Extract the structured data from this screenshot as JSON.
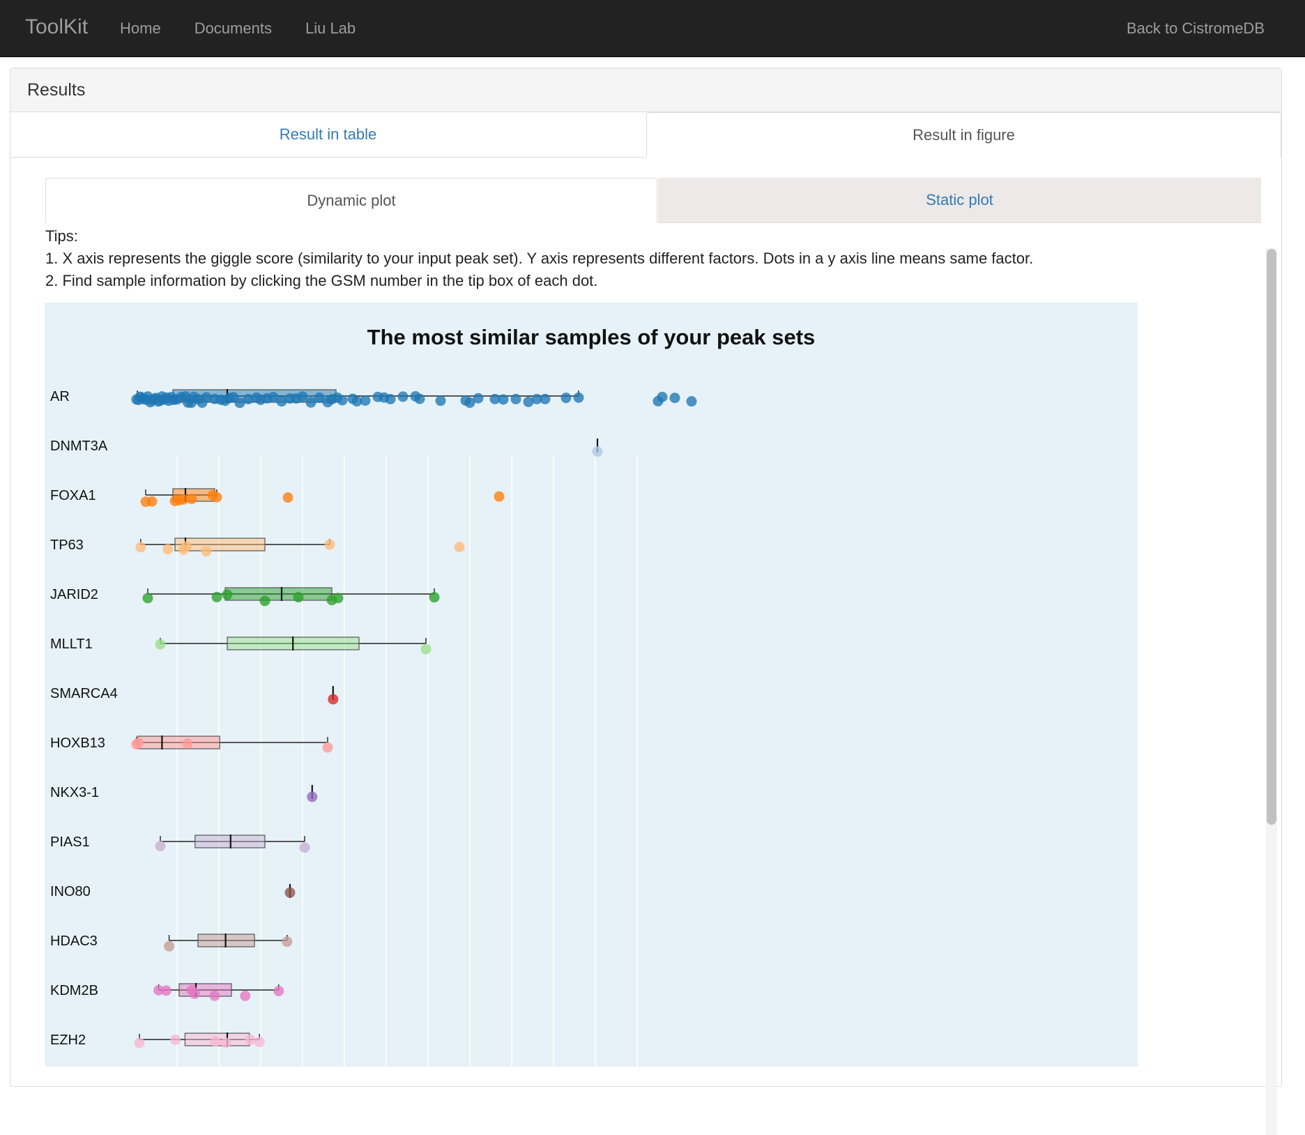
{
  "navbar": {
    "brand": "ToolKit",
    "links": [
      "Home",
      "Documents",
      "Liu Lab"
    ],
    "right_link": "Back to CistromeDB"
  },
  "panel": {
    "title": "Results"
  },
  "result_tabs": [
    {
      "label": "Result in table",
      "active": false
    },
    {
      "label": "Result in figure",
      "active": true
    }
  ],
  "plot_tabs": [
    {
      "label": "Dynamic plot",
      "active": true
    },
    {
      "label": "Static plot",
      "active": false
    }
  ],
  "tips": {
    "heading": "Tips:",
    "line1": "1. X axis represents the giggle score (similarity to your input peak set). Y axis represents different factors. Dots in a y axis line means same factor.",
    "line2": "2. Find sample information by clicking the GSM number in the tip box of each dot."
  },
  "chart_data": {
    "type": "box",
    "title": "The most similar samples of your peak sets",
    "xlabel": "",
    "ylabel": "",
    "xlim": [
      0,
      140
    ],
    "grid": true,
    "gridlines_x": [
      10,
      20,
      30,
      40,
      50,
      60,
      70,
      80,
      90,
      100,
      110,
      120
    ],
    "categories": [
      "AR",
      "DNMT3A",
      "FOXA1",
      "TP63",
      "JARID2",
      "MLLT1",
      "SMARCA4",
      "HOXB13",
      "NKX3-1",
      "PIAS1",
      "INO80",
      "HDAC3",
      "KDM2B",
      "EZH2"
    ],
    "series": [
      {
        "category": "AR",
        "color": "#1f77b4",
        "min": 0.5,
        "q1": 9,
        "median": 22,
        "q3": 48,
        "max": 106,
        "points": [
          0.3,
          0.8,
          1.2,
          1.6,
          2.1,
          2.5,
          3,
          3.6,
          4,
          4.5,
          5,
          5.5,
          6,
          6.4,
          7,
          7.5,
          8,
          8.6,
          9.2,
          10,
          11,
          12,
          12.6,
          13.4,
          14,
          15,
          16,
          17,
          19,
          20.5,
          21.5,
          22.5,
          23.5,
          25,
          27,
          29,
          30,
          31.5,
          33,
          35,
          37,
          38.5,
          40,
          42,
          44,
          46,
          47,
          48.3,
          49.5,
          52,
          53,
          55,
          58,
          59.5,
          61,
          64,
          67,
          68,
          73,
          79,
          80,
          82,
          86,
          88,
          91,
          94,
          96,
          98,
          103,
          106,
          125,
          126,
          129,
          133
        ]
      },
      {
        "category": "DNMT3A",
        "color": "#aec7e8",
        "min": 110.5,
        "q1": 110.5,
        "median": 110.5,
        "q3": 110.5,
        "max": 110.5,
        "points": [
          110.5
        ]
      },
      {
        "category": "FOXA1",
        "color": "#ff7f0e",
        "min": 2.5,
        "q1": 9,
        "median": 12,
        "q3": 19,
        "max": 19.5,
        "points": [
          2.5,
          4,
          9.5,
          10.5,
          11.5,
          13.5,
          18.5,
          19.5,
          36.5,
          87
        ]
      },
      {
        "category": "TP63",
        "color": "#ffbb78",
        "min": 1.3,
        "q1": 9.5,
        "median": 12,
        "q3": 31,
        "max": 46.5,
        "points": [
          1.3,
          7.8,
          11.6,
          12.2,
          17,
          46.5,
          77.5
        ]
      },
      {
        "category": "JARID2",
        "color": "#2ca02c",
        "min": 3,
        "q1": 21.5,
        "median": 35,
        "q3": 47,
        "max": 71.5,
        "points": [
          3,
          19.5,
          22,
          31,
          39,
          47,
          48.5,
          71.5
        ]
      },
      {
        "category": "MLLT1",
        "color": "#98df8a",
        "min": 6,
        "q1": 22,
        "median": 37.7,
        "q3": 53.5,
        "max": 69.5,
        "points": [
          6,
          69.5
        ]
      },
      {
        "category": "SMARCA4",
        "color": "#d62728",
        "min": 47.3,
        "q1": 47.3,
        "median": 47.3,
        "q3": 47.3,
        "max": 47.3,
        "points": [
          47.3
        ]
      },
      {
        "category": "HOXB13",
        "color": "#ff9896",
        "min": 0.3,
        "q1": 0.5,
        "median": 6.4,
        "q3": 20.2,
        "max": 46,
        "points": [
          0.3,
          0.8,
          12.5,
          46
        ]
      },
      {
        "category": "NKX3-1",
        "color": "#9467bd",
        "min": 42.3,
        "q1": 42.3,
        "median": 42.3,
        "q3": 42.3,
        "max": 42.3,
        "points": [
          42.3
        ]
      },
      {
        "category": "PIAS1",
        "color": "#c5b0d5",
        "min": 6,
        "q1": 14.3,
        "median": 22.8,
        "q3": 31,
        "max": 40.5,
        "points": [
          6,
          40.5
        ]
      },
      {
        "category": "INO80",
        "color": "#8c564b",
        "min": 37,
        "q1": 37,
        "median": 37,
        "q3": 37,
        "max": 37,
        "points": [
          37
        ]
      },
      {
        "category": "HDAC3",
        "color": "#c49c94",
        "min": 8.1,
        "q1": 15,
        "median": 21.6,
        "q3": 28.5,
        "max": 36.3,
        "points": [
          8.1,
          36.3
        ]
      },
      {
        "category": "KDM2B",
        "color": "#e377c2",
        "min": 5.6,
        "q1": 10.5,
        "median": 14.5,
        "q3": 23,
        "max": 34.3,
        "points": [
          5.6,
          7.4,
          13.5,
          14.2,
          19,
          26.3,
          34.3
        ]
      },
      {
        "category": "EZH2",
        "color": "#f7b6d2",
        "min": 1,
        "q1": 11.9,
        "median": 22,
        "q3": 27.3,
        "max": 29.7,
        "points": [
          1,
          9.6,
          19.2,
          21.7,
          27.5,
          29.7
        ]
      }
    ]
  }
}
